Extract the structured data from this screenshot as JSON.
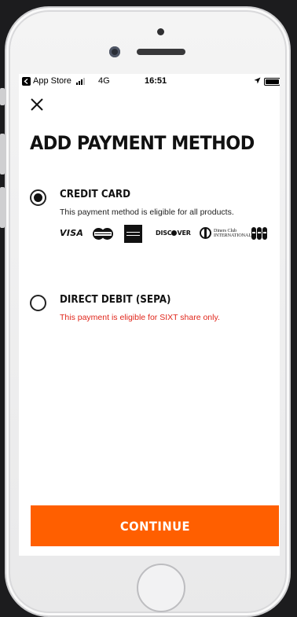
{
  "status_bar": {
    "back_app": "App Store",
    "network": "4G",
    "time": "16:51"
  },
  "header": {
    "close_icon": "close-icon",
    "title": "ADD PAYMENT METHOD"
  },
  "payment_options": [
    {
      "title": "CREDIT CARD",
      "description": "This payment method is eligible for all products.",
      "selected": true,
      "card_logos": {
        "visa": "VISA",
        "discover_left": "DISC",
        "discover_right": "VER",
        "diners_line1": "Diners Club",
        "diners_line2": "INTERNATIONAL"
      }
    },
    {
      "title": "DIRECT DEBIT (SEPA)",
      "description": "This payment is eligible for SIXT share only.",
      "selected": false
    }
  ],
  "continue_label": "CONTINUE",
  "colors": {
    "accent": "#ff5f00",
    "warning_text": "#e0261b"
  }
}
